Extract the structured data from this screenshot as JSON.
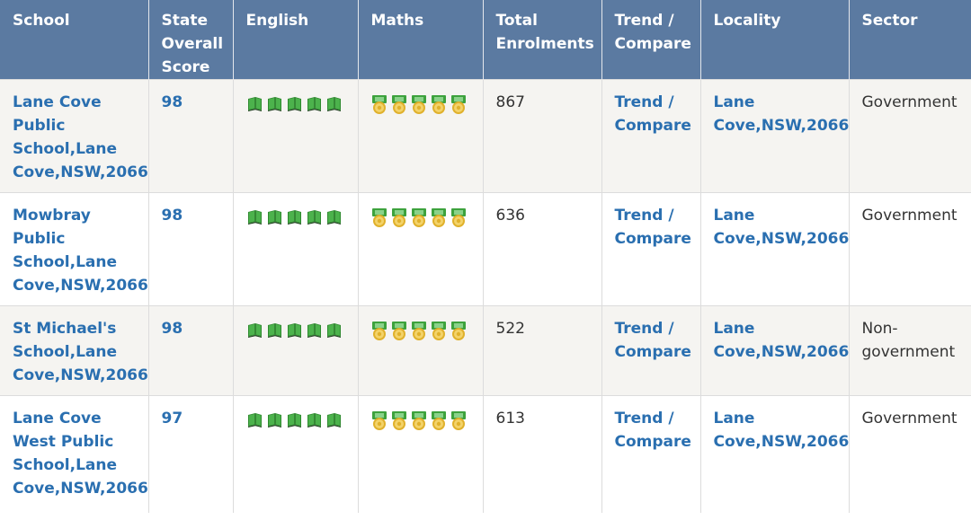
{
  "headers": {
    "school": "School",
    "score": "State Overall Score",
    "english": "English",
    "maths": "Maths",
    "enrolments": "Total Enrolments",
    "trend": "Trend / Compare",
    "locality": "Locality",
    "sector": "Sector"
  },
  "icons": {
    "english": "green-book-icon",
    "maths": "gold-medal-icon",
    "english_count": 5,
    "maths_count": 5
  },
  "colors": {
    "header_bg": "#5b7aa1",
    "link": "#2a6fb0",
    "row_alt": "#f5f4f1"
  },
  "rows": [
    {
      "school": "Lane Cove Public School,Lane Cove,NSW,2066",
      "score": "98",
      "enrolments": "867",
      "trend": "Trend / Compare",
      "locality": "Lane Cove,NSW,2066",
      "sector": "Government"
    },
    {
      "school": "Mowbray Public School,Lane Cove,NSW,2066",
      "score": "98",
      "enrolments": "636",
      "trend": "Trend / Compare",
      "locality": "Lane Cove,NSW,2066",
      "sector": "Government"
    },
    {
      "school": "St Michael's School,Lane Cove,NSW,2066",
      "score": "98",
      "enrolments": "522",
      "trend": "Trend / Compare",
      "locality": "Lane Cove,NSW,2066",
      "sector": "Non-government"
    },
    {
      "school": "Lane Cove West Public School,Lane Cove,NSW,2066",
      "score": "97",
      "enrolments": "613",
      "trend": "Trend / Compare",
      "locality": "Lane Cove,NSW,2066",
      "sector": "Government"
    }
  ]
}
